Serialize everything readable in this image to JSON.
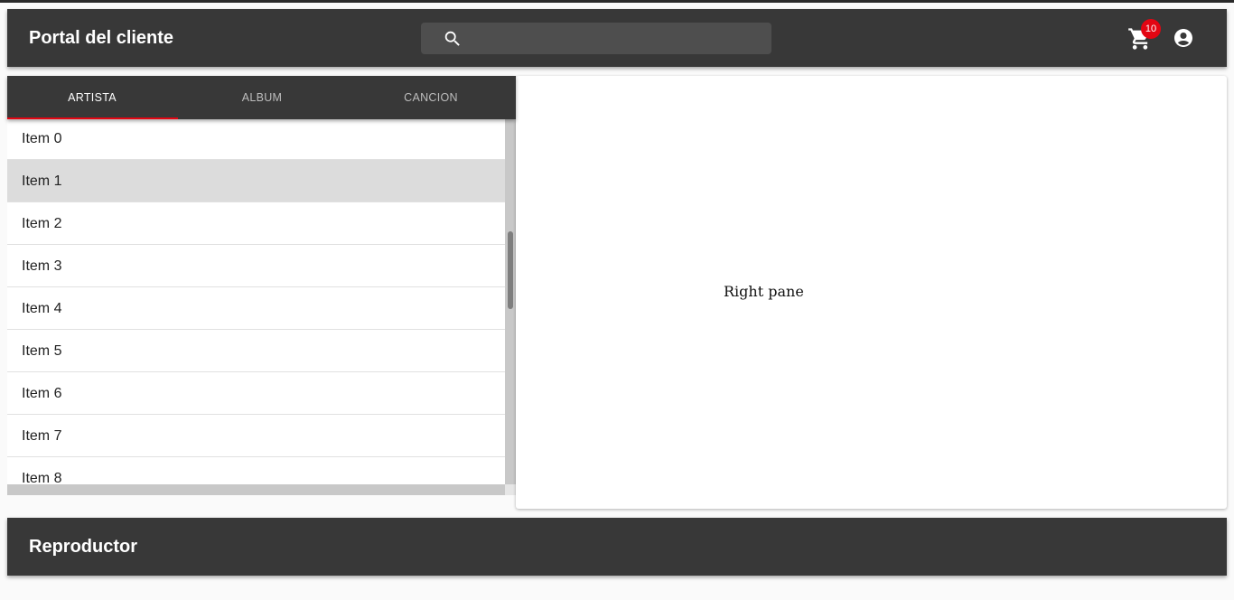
{
  "header": {
    "title": "Portal del cliente",
    "search": {
      "placeholder": "",
      "value": "",
      "icon": "search-icon"
    },
    "cart": {
      "icon": "cart-icon",
      "badge_count": "10",
      "badge_color": "#e30613"
    },
    "account": {
      "icon": "account-circle-icon"
    }
  },
  "tabs": [
    {
      "label": "ARTISTA",
      "active": true
    },
    {
      "label": "ALBUM",
      "active": false
    },
    {
      "label": "CANCION",
      "active": false
    }
  ],
  "list": {
    "selected_index": 1,
    "items": [
      "Item 0",
      "Item 1",
      "Item 2",
      "Item 3",
      "Item 4",
      "Item 5",
      "Item 6",
      "Item 7",
      "Item 8"
    ]
  },
  "right_pane": {
    "text": "Right pane"
  },
  "player": {
    "title": "Reproductor"
  },
  "colors": {
    "appbar": "#383838",
    "accent": "#e30613",
    "selected_row": "#dcdcdc"
  }
}
